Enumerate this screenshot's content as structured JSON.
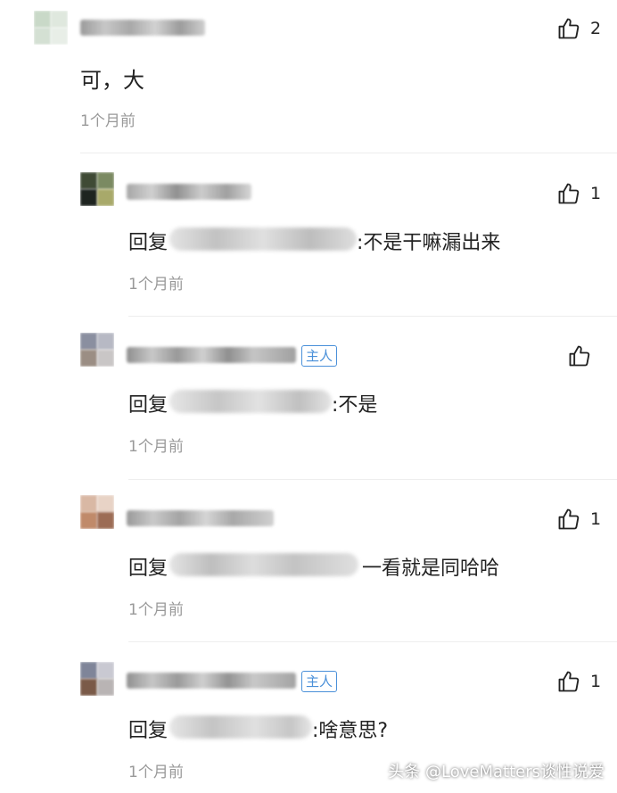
{
  "comments": [
    {
      "likes": "2",
      "text": "可，大",
      "time": "1个月前"
    },
    {
      "likes": "1",
      "reply_prefix": "回复",
      "reply_text": ":不是干嘛漏出来",
      "time": "1个月前"
    },
    {
      "likes": "",
      "badge": "主人",
      "reply_prefix": "回复",
      "reply_text": ":不是",
      "time": "1个月前"
    },
    {
      "likes": "1",
      "reply_prefix": "回复",
      "reply_text": "一看就是同哈哈",
      "time": "1个月前"
    },
    {
      "likes": "1",
      "badge": "主人",
      "reply_prefix": "回复",
      "reply_text": ":啥意思?",
      "time": "1个月前"
    }
  ],
  "watermark": "头条 @LoveMatters谈性说爱",
  "icons": {
    "like": "thumbs-up-icon"
  },
  "colors": {
    "badge": "#4a90d9",
    "time": "#999999"
  }
}
